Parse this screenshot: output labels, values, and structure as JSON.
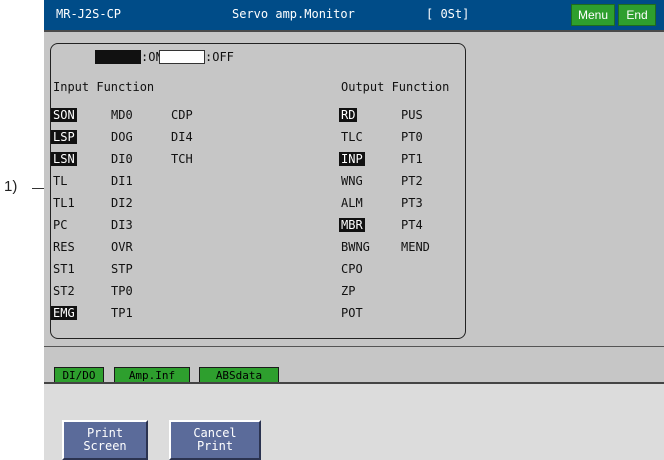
{
  "callout": {
    "label": "1)"
  },
  "titlebar": {
    "model": "MR-J2S-CP",
    "title": "Servo amp.Monitor",
    "station": "[ 0St]",
    "menu_label": "Menu",
    "end_label": "End"
  },
  "legend": {
    "on_label": ":ON",
    "off_label": ":OFF"
  },
  "input_header": "Input Function",
  "output_header": "Output Function",
  "input_signals": [
    {
      "label": "SON",
      "on": true
    },
    {
      "label": "MD0",
      "on": false
    },
    {
      "label": "CDP",
      "on": false
    },
    {
      "label": "LSP",
      "on": true
    },
    {
      "label": "DOG",
      "on": false
    },
    {
      "label": "DI4",
      "on": false
    },
    {
      "label": "LSN",
      "on": true
    },
    {
      "label": "DI0",
      "on": false
    },
    {
      "label": "TCH",
      "on": false
    },
    {
      "label": "TL",
      "on": false
    },
    {
      "label": "DI1",
      "on": false
    },
    {
      "label": "TL1",
      "on": false
    },
    {
      "label": "DI2",
      "on": false
    },
    {
      "label": "PC",
      "on": false
    },
    {
      "label": "DI3",
      "on": false
    },
    {
      "label": "RES",
      "on": false
    },
    {
      "label": "OVR",
      "on": false
    },
    {
      "label": "ST1",
      "on": false
    },
    {
      "label": "STP",
      "on": false
    },
    {
      "label": "ST2",
      "on": false
    },
    {
      "label": "TP0",
      "on": false
    },
    {
      "label": "EMG",
      "on": true
    },
    {
      "label": "TP1",
      "on": false
    }
  ],
  "output_signals": [
    {
      "label": "RD",
      "on": true
    },
    {
      "label": "PUS",
      "on": false
    },
    {
      "label": "TLC",
      "on": false
    },
    {
      "label": "PT0",
      "on": false
    },
    {
      "label": "INP",
      "on": true
    },
    {
      "label": "PT1",
      "on": false
    },
    {
      "label": "WNG",
      "on": false
    },
    {
      "label": "PT2",
      "on": false
    },
    {
      "label": "ALM",
      "on": false
    },
    {
      "label": "PT3",
      "on": false
    },
    {
      "label": "MBR",
      "on": true
    },
    {
      "label": "PT4",
      "on": false
    },
    {
      "label": "BWNG",
      "on": false
    },
    {
      "label": "MEND",
      "on": false
    },
    {
      "label": "CPO",
      "on": false
    },
    {
      "label": "ZP",
      "on": false
    },
    {
      "label": "POT",
      "on": false
    }
  ],
  "tabs": [
    "DI/DO",
    "Amp.Inf",
    "ABSdata"
  ],
  "buttons": {
    "print_line1": "Print",
    "print_line2": "Screen",
    "cancel_line1": "Cancel",
    "cancel_line2": "Print"
  },
  "colors": {
    "titlebar": "#004c88",
    "accent_green": "#2e9f2e",
    "button_blue": "#5b6b9a"
  }
}
